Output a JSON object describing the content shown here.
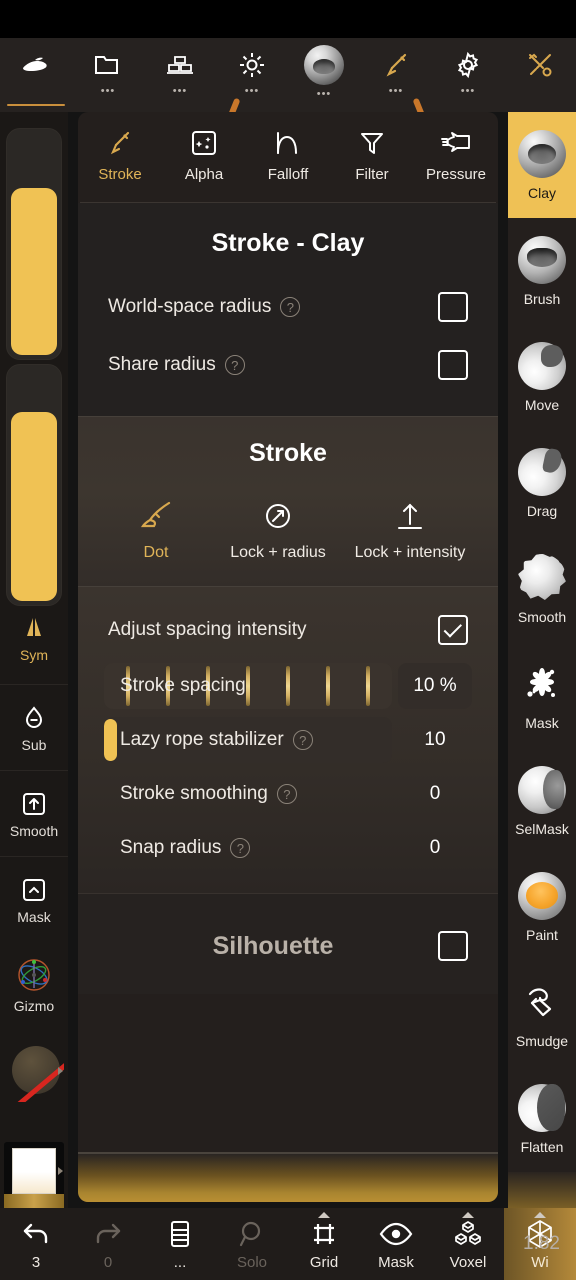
{
  "top_toolbar": {
    "items": [
      {
        "name": "sculpt-tool",
        "icon": "clay-blob-icon",
        "dots": false,
        "active": true
      },
      {
        "name": "files",
        "icon": "folder-icon",
        "dots": true,
        "active": false
      },
      {
        "name": "layers",
        "icon": "stack-icon",
        "dots": true,
        "active": false
      },
      {
        "name": "lighting",
        "icon": "sun-icon",
        "dots": true,
        "active": false
      },
      {
        "name": "material-sphere",
        "icon": "sphere-icon",
        "dots": true,
        "active": false
      },
      {
        "name": "brush",
        "icon": "brush-icon",
        "dots": true,
        "active": false
      },
      {
        "name": "settings",
        "icon": "gear-icon",
        "dots": true,
        "active": false
      },
      {
        "name": "tools",
        "icon": "tools-icon",
        "dots": false,
        "active": false
      }
    ],
    "dots_glyph": "•••"
  },
  "left_rail": {
    "slider_top": {
      "name": "radius-slider",
      "value_pct": 72
    },
    "slider_bottom": {
      "name": "intensity-slider",
      "value_pct": 78
    },
    "sym": {
      "label": "Sym",
      "icon": "symmetry-icon"
    },
    "items": [
      {
        "label": "Sub",
        "icon": "sub-drop-icon"
      },
      {
        "label": "Smooth",
        "icon": "smooth-up-icon"
      },
      {
        "label": "Mask",
        "icon": "mask-caret-icon"
      },
      {
        "label": "Gizmo",
        "icon": "gizmo-icon"
      }
    ],
    "material_swatch": {
      "name": "material-swatch",
      "disabled": true
    },
    "color_swatch": {
      "name": "color-swatch"
    }
  },
  "right_rail": {
    "brushes": [
      {
        "label": "Clay",
        "icon": "clay-sphere-icon",
        "active": true
      },
      {
        "label": "Brush",
        "icon": "brush-sphere-icon",
        "active": false
      },
      {
        "label": "Move",
        "icon": "move-sphere-icon",
        "active": false
      },
      {
        "label": "Drag",
        "icon": "drag-sphere-icon",
        "active": false
      },
      {
        "label": "Smooth",
        "icon": "smooth-sphere-icon",
        "active": false
      },
      {
        "label": "Mask",
        "icon": "mask-splat-icon",
        "active": false
      },
      {
        "label": "SelMask",
        "icon": "selmask-sphere-icon",
        "active": false
      },
      {
        "label": "Paint",
        "icon": "paint-sphere-icon",
        "active": false
      },
      {
        "label": "Smudge",
        "icon": "smudge-hand-icon",
        "active": false
      },
      {
        "label": "Flatten",
        "icon": "flatten-sphere-icon",
        "active": false
      }
    ]
  },
  "panel": {
    "tabs": [
      {
        "label": "Stroke",
        "icon": "brush-pen-icon",
        "active": true
      },
      {
        "label": "Alpha",
        "icon": "alpha-square-icon",
        "active": false
      },
      {
        "label": "Falloff",
        "icon": "falloff-curve-icon",
        "active": false
      },
      {
        "label": "Filter",
        "icon": "funnel-icon",
        "active": false
      },
      {
        "label": "Pressure",
        "icon": "pressure-hand-icon",
        "active": false
      }
    ],
    "section_stroke_clay": {
      "title": "Stroke - Clay",
      "rows": [
        {
          "label": "World-space radius",
          "hint": "?",
          "checked": false,
          "name": "world-space-radius"
        },
        {
          "label": "Share radius",
          "hint": "?",
          "checked": false,
          "name": "share-radius"
        }
      ]
    },
    "section_stroke": {
      "title": "Stroke",
      "modes": [
        {
          "label": "Dot",
          "icon": "dot-brush-icon",
          "active": true
        },
        {
          "label": "Lock + radius",
          "icon": "lock-radius-arrow-icon",
          "active": false
        },
        {
          "label": "Lock + intensity",
          "icon": "lock-intensity-arrow-icon",
          "active": false
        }
      ]
    },
    "section_spacing": {
      "toggle": {
        "label": "Adjust spacing intensity",
        "checked": true,
        "name": "adjust-spacing-intensity"
      },
      "sliders": [
        {
          "label": "Stroke spacing",
          "hint": null,
          "value": "10 %",
          "fill_pct": 10,
          "ticks": 7,
          "name": "stroke-spacing"
        },
        {
          "label": "Lazy rope stabilizer",
          "hint": "?",
          "value": "10",
          "fill_pct": 3,
          "ticks": 0,
          "name": "lazy-rope-stabilizer"
        },
        {
          "label": "Stroke smoothing",
          "hint": "?",
          "value": "0",
          "fill_pct": 0,
          "ticks": 0,
          "name": "stroke-smoothing"
        },
        {
          "label": "Snap radius",
          "hint": "?",
          "value": "0",
          "fill_pct": 0,
          "ticks": 0,
          "name": "snap-radius"
        }
      ]
    },
    "section_silhouette": {
      "title": "Silhouette",
      "checked": false
    }
  },
  "bottom_bar": {
    "items": [
      {
        "label": "3",
        "icon": "undo-icon",
        "dim": false,
        "caret": false,
        "gold": false
      },
      {
        "label": "0",
        "icon": "redo-icon",
        "dim": true,
        "caret": false,
        "gold": false
      },
      {
        "label": "...",
        "icon": "layers-book-icon",
        "dim": false,
        "caret": false,
        "gold": false
      },
      {
        "label": "Solo",
        "icon": "magnifier-icon",
        "dim": true,
        "caret": false,
        "gold": false
      },
      {
        "label": "Grid",
        "icon": "grid-frame-icon",
        "dim": false,
        "caret": true,
        "gold": false
      },
      {
        "label": "Mask",
        "icon": "eye-icon",
        "dim": false,
        "caret": false,
        "gold": false
      },
      {
        "label": "Voxel",
        "icon": "voxel-cubes-icon",
        "dim": false,
        "caret": true,
        "gold": false
      },
      {
        "label": "Wi",
        "icon": "wireframe-icon",
        "dim": false,
        "caret": true,
        "gold": true
      }
    ],
    "version": "1.82"
  },
  "colors": {
    "accent_gold": "#efc155",
    "label_gold": "#e0b458",
    "panel_bg": "#241f1d",
    "rail_bg": "#1b1816"
  }
}
